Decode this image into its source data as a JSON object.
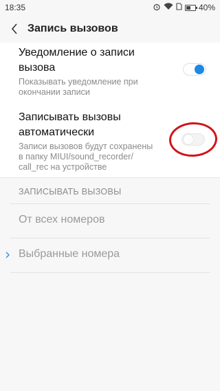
{
  "status": {
    "time": "18:35",
    "battery": "40%"
  },
  "header": {
    "title": "Запись вызовов"
  },
  "settings": {
    "notify": {
      "title_line1": "Уведомление о записи",
      "title_line2": "вызова",
      "desc_line1": "Показывать уведомление при",
      "desc_line2": "окончании записи",
      "enabled": true
    },
    "auto_record": {
      "title_line1": "Записывать вызовы",
      "title_line2": "автоматически",
      "desc_line1": "Записи вызовов будут сохранены",
      "desc_line2": "в папку MIUI/sound_recorder/",
      "desc_line3": "call_rec на устройстве",
      "enabled": false
    }
  },
  "record_section": {
    "header": "ЗАПИСЫВАТЬ ВЫЗОВЫ",
    "options": [
      {
        "label": "От всех номеров"
      },
      {
        "label": "Выбранные номера"
      }
    ]
  },
  "colors": {
    "accent": "#1e88e5",
    "annotation": "#d0141a"
  }
}
